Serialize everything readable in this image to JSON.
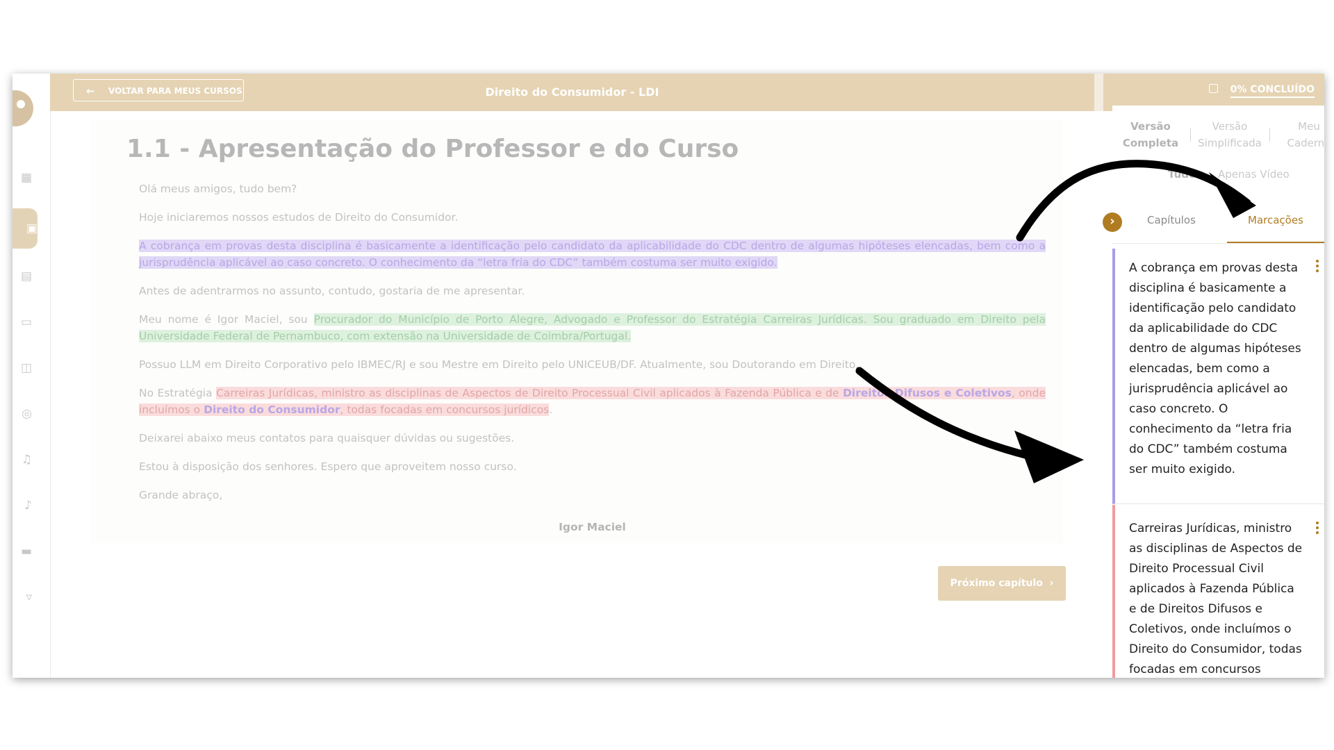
{
  "header": {
    "back_label": "VOLTAR PARA MEUS CURSOS",
    "course_title": "Direito do Consumidor - LDI",
    "progress_label": "0% CONCLUÍDO"
  },
  "lesson": {
    "title": "1.1 - Apresentação do Professor e do Curso",
    "p1": "Olá meus amigos, tudo bem?",
    "p2": "Hoje iniciaremos nossos estudos de Direito do Consumidor.",
    "p3_highlight": "A cobrança em provas desta disciplina é basicamente a identificação pelo candidato da aplicabilidade do CDC dentro de algumas hipóteses elencadas, bem como a jurisprudência aplicável ao caso concreto. O conhecimento da “letra fria do CDC” também costuma ser muito exigido.",
    "p4": "Antes de adentrarmos no assunto, contudo, gostaria de me apresentar.",
    "p5_plain": "Meu nome é Igor Maciel, sou ",
    "p5_highlight": "Procurador do Município de Porto Alegre, Advogado e Professor do Estratégia Carreiras Jurídicas. Sou graduado em Direito pela Universidade Federal de Pernambuco, com extensão na Universidade de Coimbra/Portugal.",
    "p6": "Possuo LLM em Direito Corporativo pelo IBMEC/RJ e sou Mestre em Direito pelo UNICEUB/DF. Atualmente, sou Doutorando em Direito.",
    "p7_plain": "No Estratégia ",
    "p7_highlight_a": "Carreiras Jurídicas, ministro as disciplinas de Aspectos de Direito Processual Civil aplicados à Fazenda Pública e de ",
    "p7_bold_a": "Direitos Difusos e Coletivos",
    "p7_highlight_b": ", onde incluímos o ",
    "p7_bold_b": "Direito do Consumidor",
    "p7_highlight_c": ", todas focadas em concursos jurídicos",
    "p7_end": ".",
    "p8": "Deixarei abaixo meus contatos para quaisquer dúvidas ou sugestões.",
    "p9": "Estou à disposição dos senhores. Espero que aproveitem nosso curso.",
    "p10": "Grande abraço,",
    "signature": "Igor Maciel"
  },
  "next_button": "Próximo capítulo",
  "sidebar": {
    "versions": [
      {
        "line1": "Versão",
        "line2": "Completa"
      },
      {
        "line1": "Versão",
        "line2": "Simplificada"
      },
      {
        "line1": "Meu",
        "line2": "Caderno"
      }
    ],
    "filters": [
      "Tudo",
      "Apenas Vídeo"
    ],
    "tabs": [
      "Capítulos",
      "Marcações"
    ],
    "marks": [
      {
        "text": "A cobrança em provas desta disciplina é basicamente a identificação pelo candidato da aplicabilidade do CDC dentro de algumas hipóteses elencadas, bem como a jurisprudência aplicável ao caso concreto. O conhecimento da “letra fria do CDC” também costuma ser muito exigido.",
        "color": "#a99ce8"
      },
      {
        "text": "Carreiras Jurídicas, ministro as disciplinas de Aspectos de Direito Processual Civil aplicados à Fazenda Pública e de Direitos Difusos e Coletivos, onde incluímos o Direito do Consumidor, todas focadas em concursos jurídicos",
        "color": "#ef9c9c"
      }
    ]
  },
  "colors": {
    "brand": "#e5d3b3",
    "accent": "#b07c22",
    "highlight_purple": "#e0d8f6",
    "highlight_green": "#ddf1de",
    "highlight_red": "#fadcdc"
  },
  "icons": [
    "logo-icon",
    "back-arrow-icon",
    "progress-icon",
    "chevron-right-icon",
    "more-vert-icon",
    "annotation-arrow-icon"
  ]
}
